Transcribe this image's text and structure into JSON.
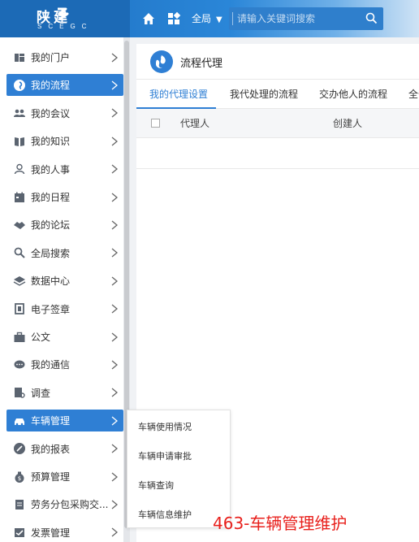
{
  "header": {
    "logo_cn": "陕建",
    "logo_en": "SCEGC",
    "scope_label": "全局",
    "search_placeholder": "请输入关键词搜索"
  },
  "sidebar": {
    "items": [
      {
        "label": "我的门户",
        "icon": "portal-icon",
        "active": false
      },
      {
        "label": "我的流程",
        "icon": "workflow-icon",
        "active": true
      },
      {
        "label": "我的会议",
        "icon": "meeting-icon",
        "active": false
      },
      {
        "label": "我的知识",
        "icon": "book-icon",
        "active": false
      },
      {
        "label": "我的人事",
        "icon": "person-icon",
        "active": false
      },
      {
        "label": "我的日程",
        "icon": "calendar-icon",
        "active": false
      },
      {
        "label": "我的论坛",
        "icon": "handshake-icon",
        "active": false
      },
      {
        "label": "全局搜索",
        "icon": "search-icon",
        "active": false
      },
      {
        "label": "数据中心",
        "icon": "layers-icon",
        "active": false
      },
      {
        "label": "电子签章",
        "icon": "stamp-icon",
        "active": false
      },
      {
        "label": "公文",
        "icon": "briefcase-icon",
        "active": false
      },
      {
        "label": "我的通信",
        "icon": "chat-icon",
        "active": false
      },
      {
        "label": "调查",
        "icon": "survey-icon",
        "active": false
      },
      {
        "label": "车辆管理",
        "icon": "car-icon",
        "active": true
      },
      {
        "label": "我的报表",
        "icon": "report-icon",
        "active": false
      },
      {
        "label": "预算管理",
        "icon": "budget-icon",
        "active": false
      },
      {
        "label": "劳务分包采购交...",
        "icon": "document-icon",
        "active": false
      },
      {
        "label": "发票管理",
        "icon": "invoice-icon",
        "active": false
      }
    ]
  },
  "panel": {
    "title": "流程代理",
    "tabs": [
      {
        "label": "我的代理设置",
        "active": true
      },
      {
        "label": "我代处理的流程",
        "active": false
      },
      {
        "label": "交办他人的流程",
        "active": false
      },
      {
        "label": "全部",
        "active": false
      }
    ],
    "columns": [
      "代理人",
      "创建人"
    ]
  },
  "submenu": {
    "items": [
      "车辆使用情况",
      "车辆申请审批",
      "车辆查询",
      "车辆信息维护"
    ]
  },
  "caption": "463-车辆管理维护",
  "colors": {
    "accent": "#2f7fd4",
    "header": "#1d6fbf",
    "caption": "#e8201c"
  }
}
